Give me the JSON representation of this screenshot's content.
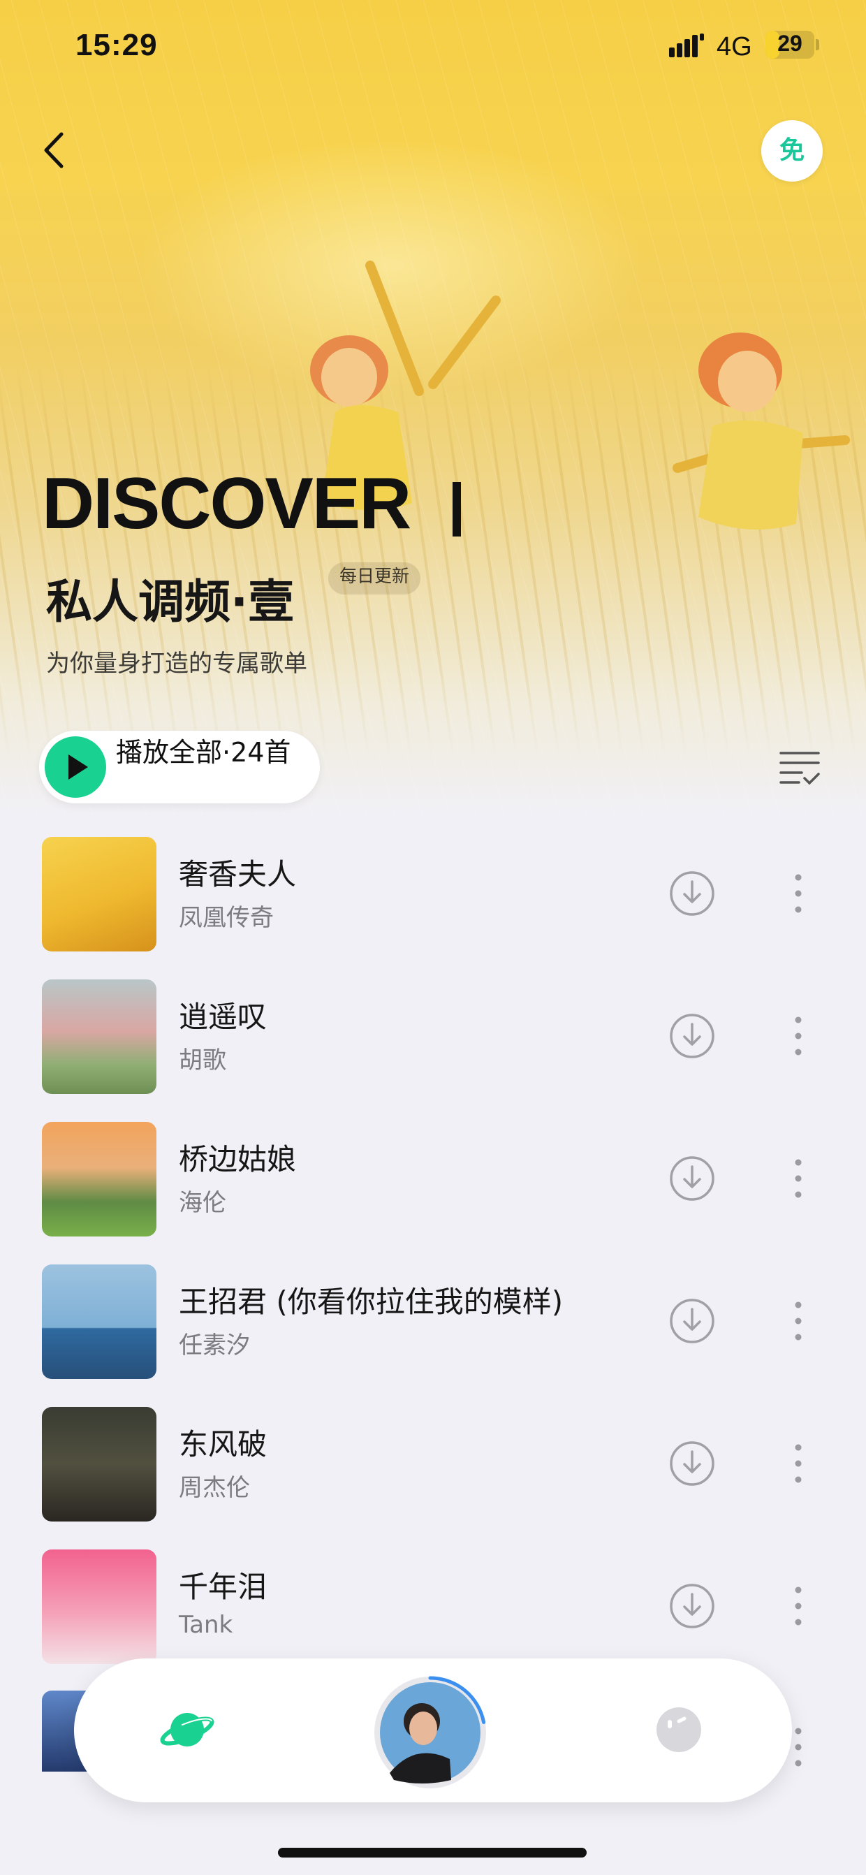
{
  "status_bar": {
    "time": "15:29",
    "network": "4G",
    "battery": "29",
    "battery_level": 0.29,
    "icons": [
      "signal-icon",
      "battery-icon"
    ]
  },
  "top_bar": {
    "back_icon": "chevron-left-icon",
    "free_label": "免"
  },
  "hero": {
    "title": "DISCOVER",
    "subtitle": "私人调频·壹",
    "badge": "每日更新",
    "description": "为你量身打造的专属歌单"
  },
  "actions": {
    "play_all": "播放全部·24首",
    "play_icon": "play-icon",
    "sort_icon": "list-sort-icon"
  },
  "songs": [
    {
      "title": "奢香夫人",
      "artist": "凤凰传奇",
      "cover": "wheat-field-kids"
    },
    {
      "title": "逍遥叹",
      "artist": "胡歌",
      "cover": "pink-landscape"
    },
    {
      "title": "桥边姑娘",
      "artist": "海伦",
      "cover": "sunset-trees"
    },
    {
      "title": "王招君 (你看你拉住我的模样)",
      "artist": "任素汐",
      "cover": "tree-on-water"
    },
    {
      "title": "东风破",
      "artist": "周杰伦",
      "cover": "man-portrait"
    },
    {
      "title": "千年泪",
      "artist": "Tank",
      "cover": "pink-clouds"
    }
  ],
  "bottom_nav": {
    "items": [
      "planet-icon",
      "now-playing-disc",
      "face-icon"
    ],
    "now_playing_progress": 0.22
  },
  "colors": {
    "accent": "#19d291",
    "accent_text": "#19c79a",
    "hero_yellow": "#f6cf46",
    "background": "#f1f0f6"
  }
}
